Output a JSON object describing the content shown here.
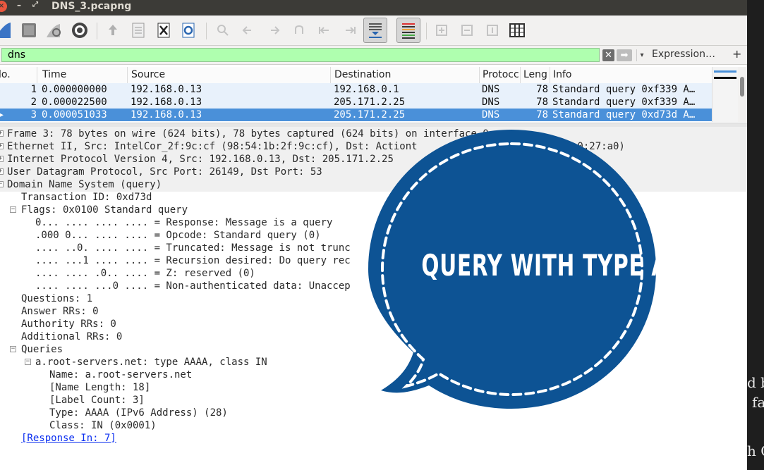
{
  "window": {
    "title": "DNS_3.pcapng"
  },
  "toolbar": {
    "icons": [
      "shark-fin-icon",
      "stop-icon",
      "restart-icon",
      "options-gear-icon",
      "open-file-icon",
      "file-icon",
      "close-file-icon",
      "reload-icon",
      "zoom-search-icon",
      "back-icon",
      "forward-icon",
      "go-to-packet-icon",
      "first-packet-icon",
      "last-packet-icon",
      "autoscroll-icon",
      "colorize-icon",
      "zoom-in-icon",
      "zoom-out-icon",
      "normal-size-icon",
      "resize-columns-icon"
    ]
  },
  "filter": {
    "value": "dns",
    "expression_label": "Expression…",
    "plus_label": "+",
    "bg_color": "#afffaf"
  },
  "packet_list": {
    "columns": [
      "lo.",
      "Time",
      "Source",
      "Destination",
      "Protocc",
      "Leng",
      "Info"
    ],
    "rows": [
      {
        "no": "1",
        "time": "0.000000000",
        "source": "192.168.0.13",
        "destination": "192.168.0.1",
        "protocol": "DNS",
        "length": "78",
        "info": "Standard query 0xf339 A…"
      },
      {
        "no": "2",
        "time": "0.000022500",
        "source": "192.168.0.13",
        "destination": "205.171.2.25",
        "protocol": "DNS",
        "length": "78",
        "info": "Standard query 0xf339 A…"
      },
      {
        "no": "3",
        "time": "0.000051033",
        "source": "192.168.0.13",
        "destination": "205.171.2.25",
        "protocol": "DNS",
        "length": "78",
        "info": "Standard query 0xd73d A…"
      }
    ],
    "selected_row_marker": "▸"
  },
  "details": {
    "lines": [
      "Frame 3: 78 bytes on wire (624 bits), 78 bytes captured (624 bits) on interface 0",
      "Ethernet II, Src: IntelCor_2f:9c:cf (98:54:1b:2f:9c:cf), Dst: Actiont",
      "c0:27:a0)",
      "Internet Protocol Version 4, Src: 192.168.0.13, Dst: 205.171.2.25",
      "User Datagram Protocol, Src Port: 26149, Dst Port: 53",
      "Domain Name System (query)",
      "Transaction ID: 0xd73d",
      "Flags: 0x0100 Standard query",
      "0... .... .... .... = Response: Message is a query",
      ".000 0... .... .... = Opcode: Standard query (0)",
      ".... ..0. .... .... = Truncated: Message is not trunc",
      ".... ...1 .... .... = Recursion desired: Do query rec",
      ".... .... .0.. .... = Z: reserved (0)",
      ".... .... ...0 .... = Non-authenticated data: Unaccep",
      "Questions: 1",
      "Answer RRs: 0",
      "Authority RRs: 0",
      "Additional RRs: 0",
      "Queries",
      "a.root-servers.net: type AAAA, class IN",
      "Name: a.root-servers.net",
      "[Name Length: 18]",
      "[Label Count: 3]",
      "Type: AAAA (IPv6 Address) (28)",
      "Class: IN (0x0001)",
      "[Response In: 7]"
    ]
  },
  "overlay": {
    "bubble_text": "QUERY WITH TYPE AAAA",
    "bubble_color": "#0d5394"
  },
  "background_fragments": [
    "d b",
    "fa",
    "h G"
  ]
}
